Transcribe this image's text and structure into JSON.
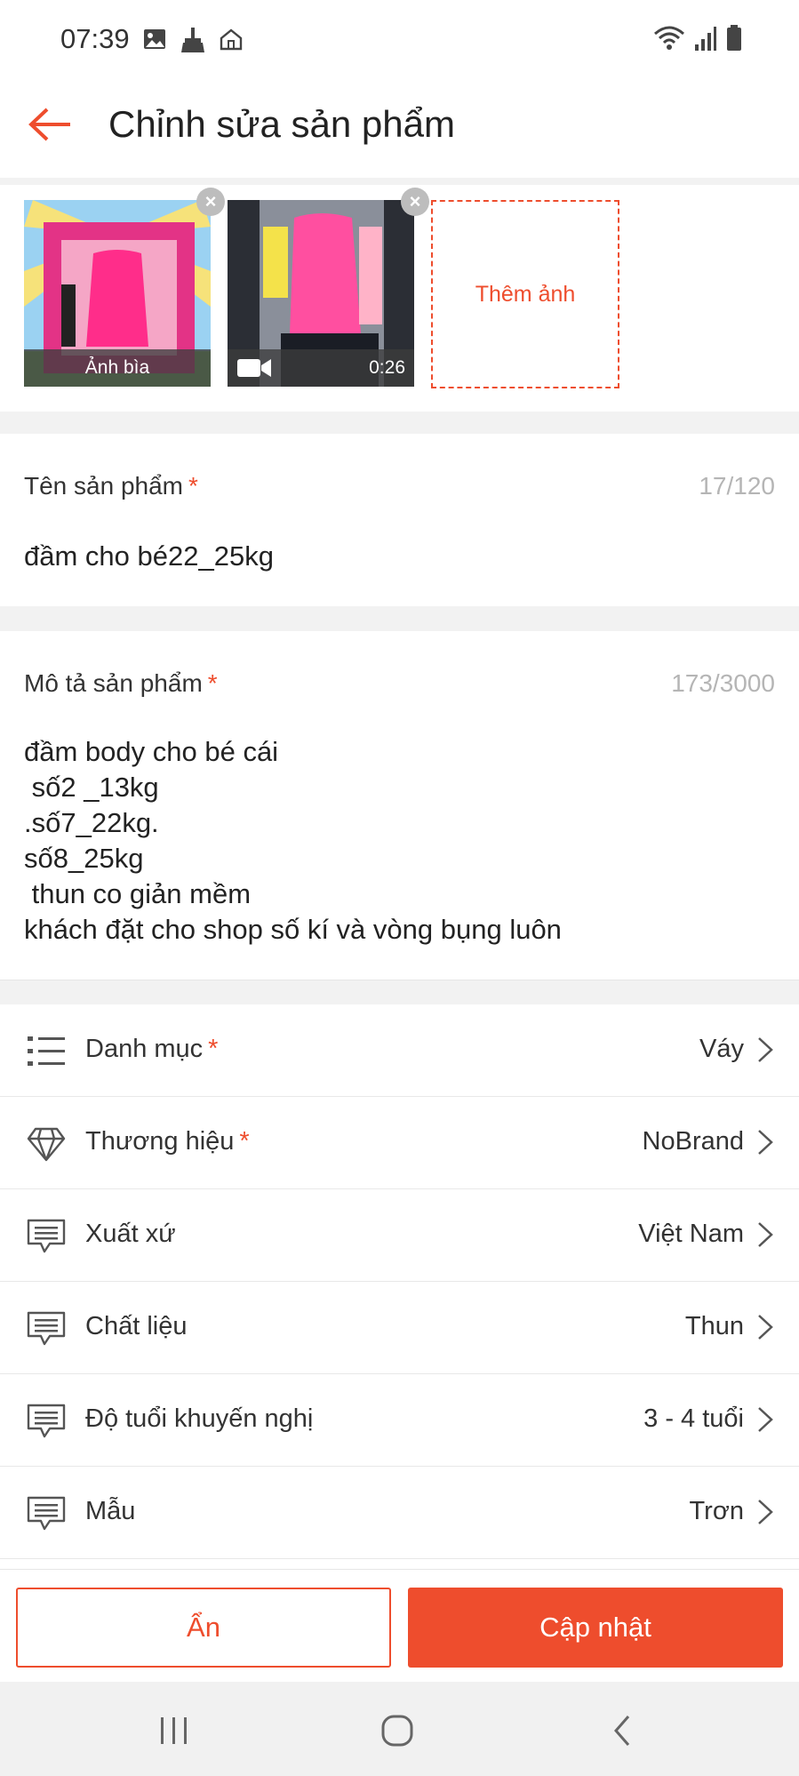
{
  "status_bar": {
    "time": "07:39"
  },
  "header": {
    "title": "Chỉnh sửa sản phẩm"
  },
  "media": {
    "cover_label": "Ảnh bìa",
    "video_duration": "0:26",
    "add_photo_label": "Thêm ảnh"
  },
  "name_field": {
    "label": "Tên sản phẩm",
    "required_mark": "*",
    "counter": "17/120",
    "value": "đầm cho bé22_25kg"
  },
  "description_field": {
    "label": "Mô tả sản phẩm",
    "required_mark": "*",
    "counter": "173/3000",
    "lines": [
      "đầm body cho bé cái",
      " số2 _13kg",
      ".số7_22kg.",
      "số8_25kg",
      " thun co giản mềm",
      "khách đặt cho shop số kí và vòng bụng luôn"
    ]
  },
  "attributes": [
    {
      "label": "Danh mục",
      "required": "*",
      "value": "Váy",
      "icon": "list-icon"
    },
    {
      "label": "Thương hiệu",
      "required": "*",
      "value": "NoBrand",
      "icon": "diamond-icon"
    },
    {
      "label": "Xuất xứ",
      "required": "",
      "value": "Việt Nam",
      "icon": "message-icon"
    },
    {
      "label": "Chất liệu",
      "required": "",
      "value": "Thun",
      "icon": "message-icon"
    },
    {
      "label": "Độ tuổi khuyến nghị",
      "required": "",
      "value": "3 - 4 tuổi",
      "icon": "message-icon"
    },
    {
      "label": "Mẫu",
      "required": "",
      "value": "Trơn",
      "icon": "message-icon"
    }
  ],
  "actions": {
    "hide_label": "Ẩn",
    "update_label": "Cập nhật"
  },
  "colors": {
    "accent": "#ee4d2d",
    "divider": "#f2f2f2"
  }
}
